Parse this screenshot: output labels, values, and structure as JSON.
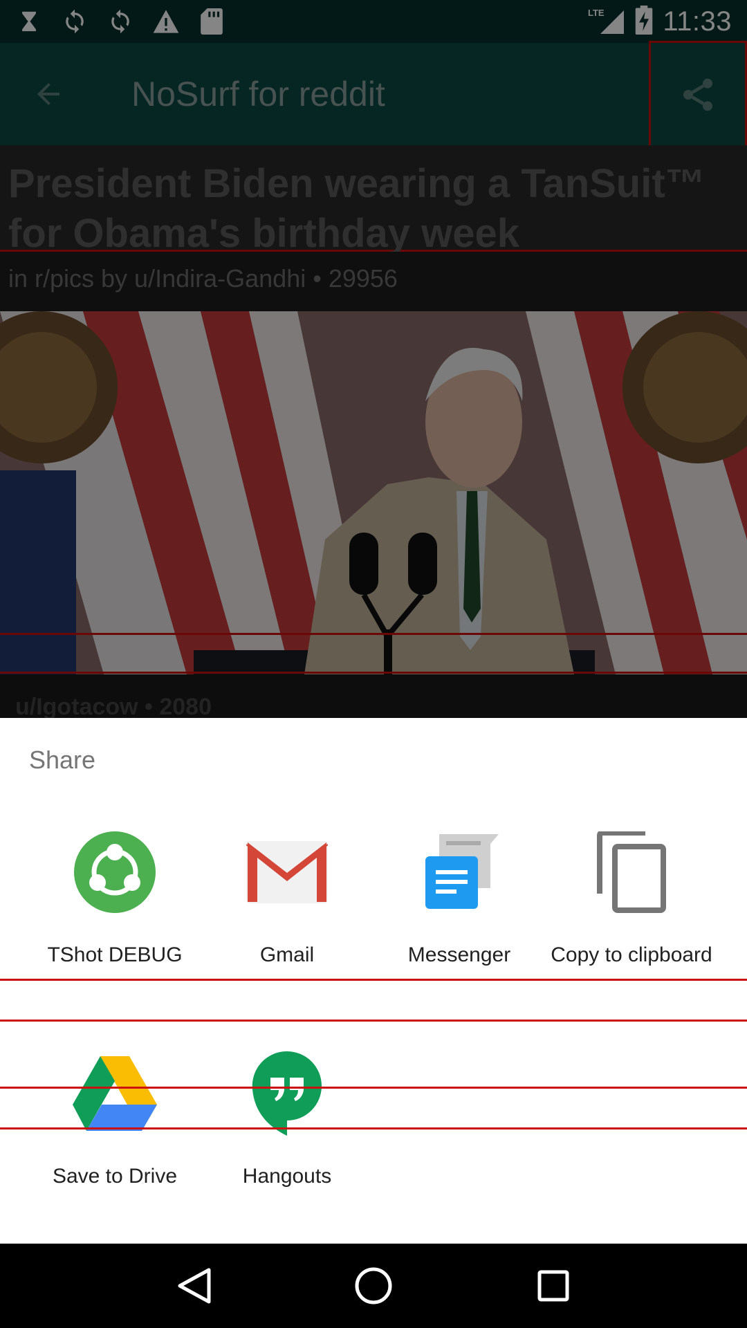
{
  "status_bar": {
    "time": "11:33",
    "network": "LTE",
    "icons": [
      "hourglass-icon",
      "sync-icon",
      "sync-icon",
      "warning-icon",
      "sd-card-icon"
    ]
  },
  "app_bar": {
    "title": "NoSurf for reddit",
    "back_icon": "arrow-back-icon",
    "share_icon": "share-icon"
  },
  "post": {
    "title": "President Biden wearing a TanSuit™ for Obama's birthday week",
    "meta": "in r/pics by u/Indira-Gandhi • 29956",
    "comment_meta": "u/Igotacow • 2080"
  },
  "share_sheet": {
    "title": "Share",
    "targets": [
      {
        "label": "TShot DEBUG",
        "icon": "tshot-icon"
      },
      {
        "label": "Gmail",
        "icon": "gmail-icon"
      },
      {
        "label": "Messenger",
        "icon": "messenger-icon"
      },
      {
        "label": "Copy to clipboard",
        "icon": "copy-icon"
      },
      {
        "label": "Save to Drive",
        "icon": "drive-icon"
      },
      {
        "label": "Hangouts",
        "icon": "hangouts-icon"
      }
    ]
  },
  "colors": {
    "status_bar": "#04312d",
    "app_bar": "#0b4a44",
    "highlight_box": "#cc1111"
  },
  "nav_bar": {
    "icons": [
      "back-triangle-icon",
      "home-circle-icon",
      "recents-square-icon"
    ]
  }
}
